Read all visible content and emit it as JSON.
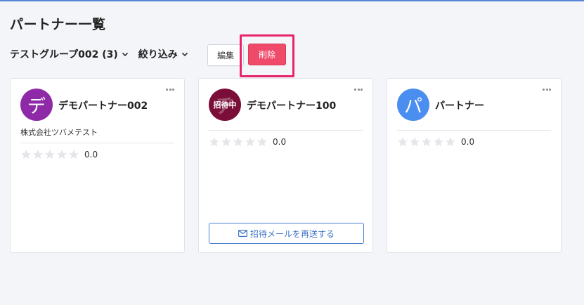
{
  "header": {
    "title": "パートナー一覧"
  },
  "toolbar": {
    "group_select": "テストグループ002 (3)",
    "filter_label": "絞り込み",
    "edit_label": "編集",
    "delete_label": "削除"
  },
  "cards": [
    {
      "name": "デモパートナー002",
      "avatar_text": "デ",
      "avatar_color": "#8e2aa8",
      "company": "株式会社ツバメテスト",
      "rating": "0.0"
    },
    {
      "name": "デモパートナー100",
      "avatar_text": "招待中",
      "avatar_color": "#7a0e38",
      "rating": "0.0",
      "resend_label": "招待メールを再送する"
    },
    {
      "name": "パートナー",
      "avatar_text": "パ",
      "avatar_color": "#4a8ef0",
      "rating": "0.0"
    }
  ],
  "colors": {
    "accent": "#4a7fd0",
    "danger": "#ef4a6a",
    "highlight": "#e8246c"
  }
}
